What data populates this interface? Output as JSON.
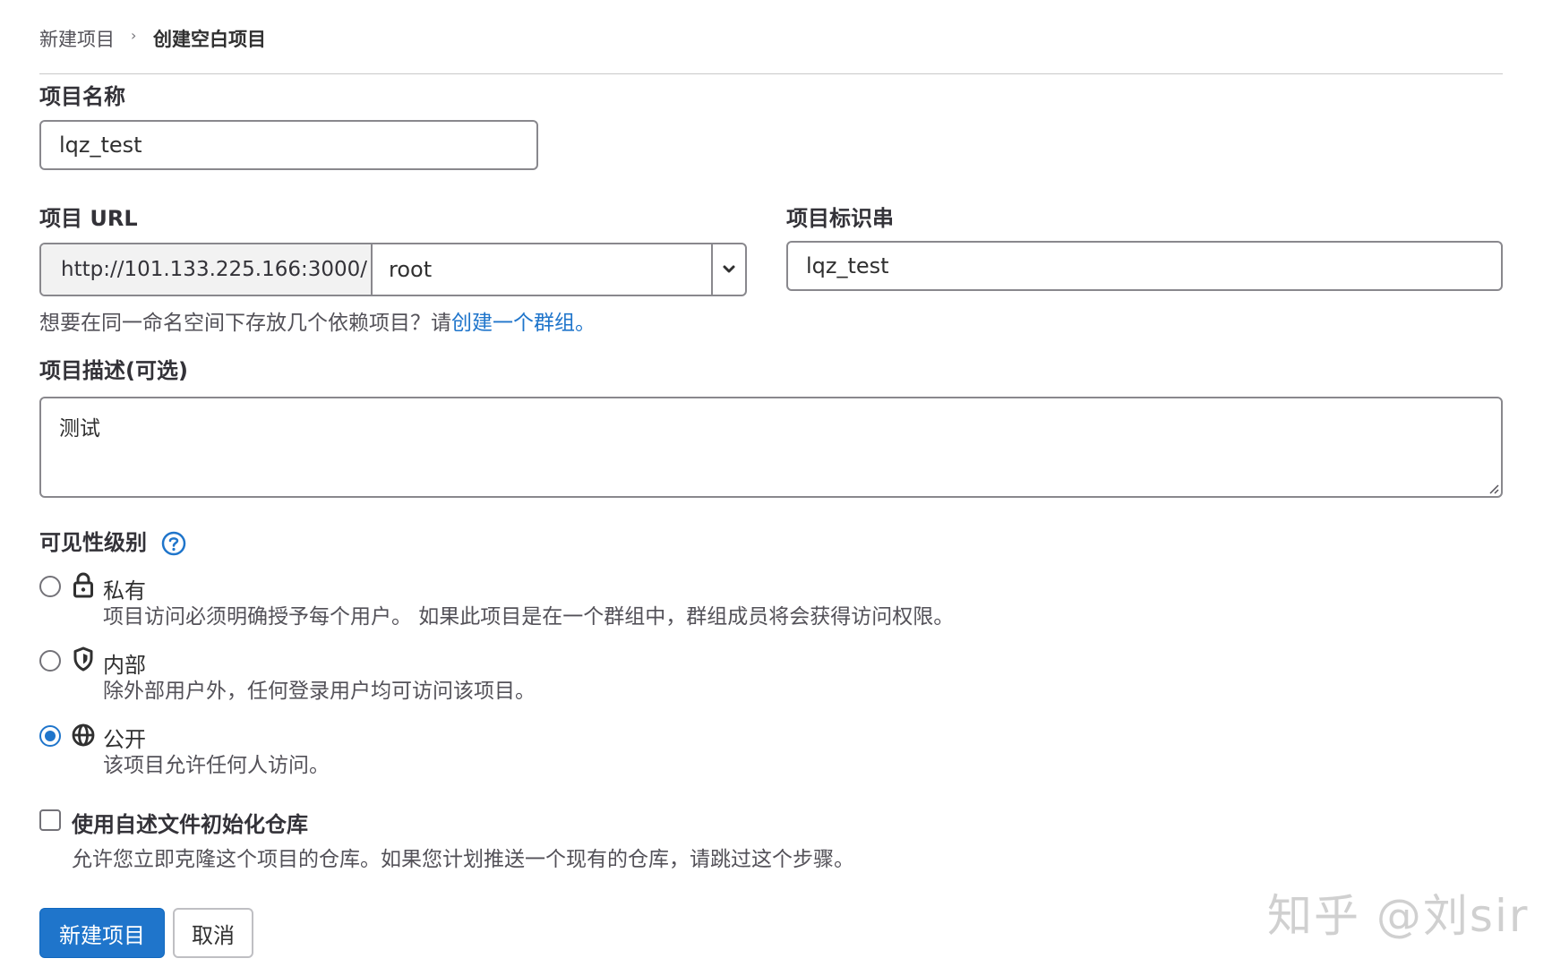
{
  "breadcrumb": {
    "parent": "新建项目",
    "separator": "›",
    "current": "创建空白项目"
  },
  "form": {
    "name_label": "项目名称",
    "name_value": "lqz_test",
    "url_label": "项目 URL",
    "url_prefix": "http://101.133.225.166:3000/",
    "namespace_value": "root",
    "slug_label": "项目标识串",
    "slug_value": "lqz_test",
    "namespace_hint": "想要在同一命名空间下存放几个依赖项目？请",
    "namespace_hint_link": "创建一个群组。",
    "description_label": "项目描述(可选)",
    "description_value": "测试",
    "visibility_label": "可见性级别",
    "visibility_options": [
      {
        "title": "私有",
        "icon": "lock-icon",
        "desc": "项目访问必须明确授予每个用户。 如果此项目是在一个群组中，群组成员将会获得访问权限。",
        "checked": false
      },
      {
        "title": "内部",
        "icon": "shield-icon",
        "desc": "除外部用户外，任何登录用户均可访问该项目。",
        "checked": false
      },
      {
        "title": "公开",
        "icon": "globe-icon",
        "desc": "该项目允许任何人访问。",
        "checked": true
      }
    ],
    "readme_label": "使用自述文件初始化仓库",
    "readme_desc": "允许您立即克隆这个项目的仓库。如果您计划推送一个现有的仓库，请跳过这个步骤。",
    "readme_checked": false
  },
  "buttons": {
    "create": "新建项目",
    "cancel": "取消"
  },
  "watermark": "知乎 @刘sir",
  "colors": {
    "primary": "#1f75cb",
    "border": "#89888d",
    "muted_text": "#535158"
  }
}
